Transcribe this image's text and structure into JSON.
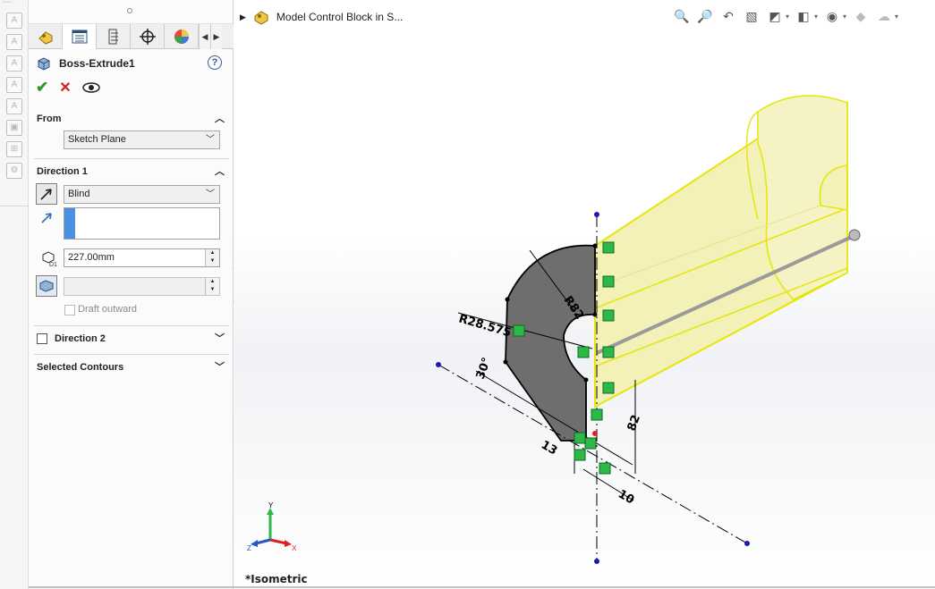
{
  "panel": {
    "feature_title": "Boss-Extrude1",
    "help_label": "?",
    "from": {
      "header": "From",
      "start_condition": "Sketch Plane"
    },
    "direction1": {
      "header": "Direction 1",
      "end_condition": "Blind",
      "depth_value": "227.00mm",
      "depth_icon_label": "D1",
      "draft_value": "",
      "draft_outward_label": "Draft outward"
    },
    "direction2": {
      "header": "Direction 2"
    },
    "selected_contours": {
      "header": "Selected Contours"
    }
  },
  "graphics": {
    "tree_label": "Model Control Block in S...",
    "view_name": "*Isometric",
    "dimensions": {
      "r_large": "R82",
      "r_small": "R28.575",
      "angle": "30°",
      "dim_13": "13",
      "dim_10": "10",
      "dim_82": "82"
    },
    "triad": {
      "x": "X",
      "y": "Y",
      "z": "Z"
    }
  },
  "colors": {
    "accent_blue": "#4a90e2",
    "part_fill": "#f3f0b8",
    "part_edge": "#e6e60a",
    "sketch_face": "#6e6e6e",
    "relation_green": "#2fb84a",
    "ok_green": "#2e9b2e",
    "cancel_red": "#d02020"
  },
  "icons": {
    "hud": [
      "zoom-to-fit-icon",
      "zoom-area-icon",
      "previous-view-icon",
      "section-view-icon",
      "view-orientation-icon",
      "display-style-icon",
      "hide-show-icon",
      "edit-appearance-icon",
      "apply-scene-icon"
    ]
  }
}
